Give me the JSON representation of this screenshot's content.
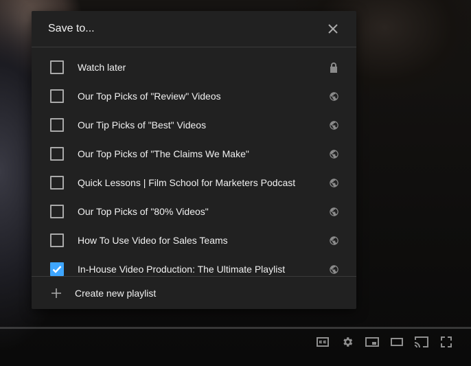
{
  "dialog": {
    "title": "Save to...",
    "playlists": [
      {
        "label": "Watch later",
        "checked": false,
        "privacy": "lock-icon"
      },
      {
        "label": "Our Top Picks of \"Review\" Videos",
        "checked": false,
        "privacy": "globe-icon"
      },
      {
        "label": "Our Tip Picks of \"Best\" Videos",
        "checked": false,
        "privacy": "globe-icon"
      },
      {
        "label": "Our Top Picks of \"The Claims We Make\"",
        "checked": false,
        "privacy": "globe-icon"
      },
      {
        "label": "Quick Lessons | Film School for Marketers Podcast",
        "checked": false,
        "privacy": "globe-icon"
      },
      {
        "label": "Our Top Picks of \"80% Videos\"",
        "checked": false,
        "privacy": "globe-icon"
      },
      {
        "label": "How To Use Video for Sales Teams",
        "checked": false,
        "privacy": "globe-icon"
      },
      {
        "label": "In-House Video Production: The Ultimate Playlist",
        "checked": true,
        "privacy": "globe-icon"
      }
    ],
    "footer": {
      "create_label": "Create new playlist"
    }
  },
  "player_controls": [
    "captions-icon",
    "settings-gear-icon",
    "miniplayer-icon",
    "theater-mode-icon",
    "cast-icon",
    "fullscreen-icon"
  ],
  "colors": {
    "accent": "#3ea6ff",
    "dialog_bg": "#212121"
  }
}
